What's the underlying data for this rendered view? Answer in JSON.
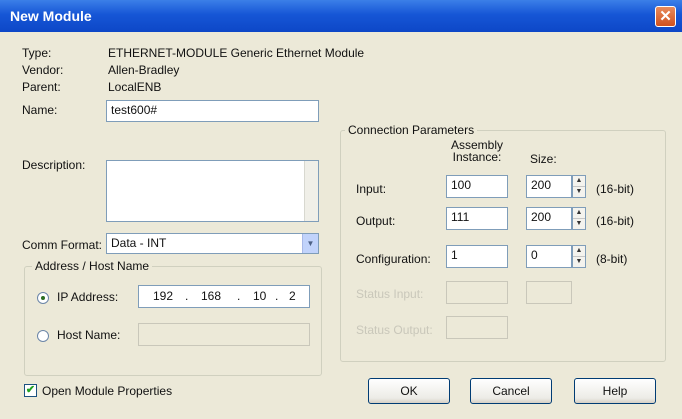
{
  "window": {
    "title": "New Module"
  },
  "info": {
    "type_label": "Type:",
    "type_value": "ETHERNET-MODULE Generic Ethernet Module",
    "vendor_label": "Vendor:",
    "vendor_value": "Allen-Bradley",
    "parent_label": "Parent:",
    "parent_value": "LocalENB"
  },
  "form": {
    "name_label": "Name:",
    "name_value": "test600#",
    "description_label": "Description:",
    "description_value": "",
    "comm_format_label": "Comm Format:",
    "comm_format_value": "Data - INT"
  },
  "address_group": {
    "title": "Address / Host Name",
    "ip_label": "IP Address:",
    "ip": [
      "192",
      "168",
      "10",
      "2"
    ],
    "ip_selected": true,
    "host_label": "Host Name:",
    "host_value": ""
  },
  "connection": {
    "title": "Connection Parameters",
    "col_assembly": "Assembly Instance:",
    "col_size": "Size:",
    "rows": [
      {
        "label": "Input:",
        "instance": "100",
        "size": "200",
        "unit": "(16-bit)"
      },
      {
        "label": "Output:",
        "instance": "111",
        "size": "200",
        "unit": "(16-bit)"
      },
      {
        "label": "Configuration:",
        "instance": "1",
        "size": "0",
        "unit": "(8-bit)"
      }
    ],
    "disabled_rows": [
      {
        "label": "Status Input:"
      },
      {
        "label": "Status Output:"
      }
    ]
  },
  "footer": {
    "open_props_label": "Open Module Properties",
    "open_props_checked": true,
    "ok_label": "OK",
    "cancel_label": "Cancel",
    "help_label": "Help"
  },
  "icons": {
    "close": "close-icon",
    "dropdown": "chevron-down-icon",
    "check": "checkmark-icon"
  }
}
